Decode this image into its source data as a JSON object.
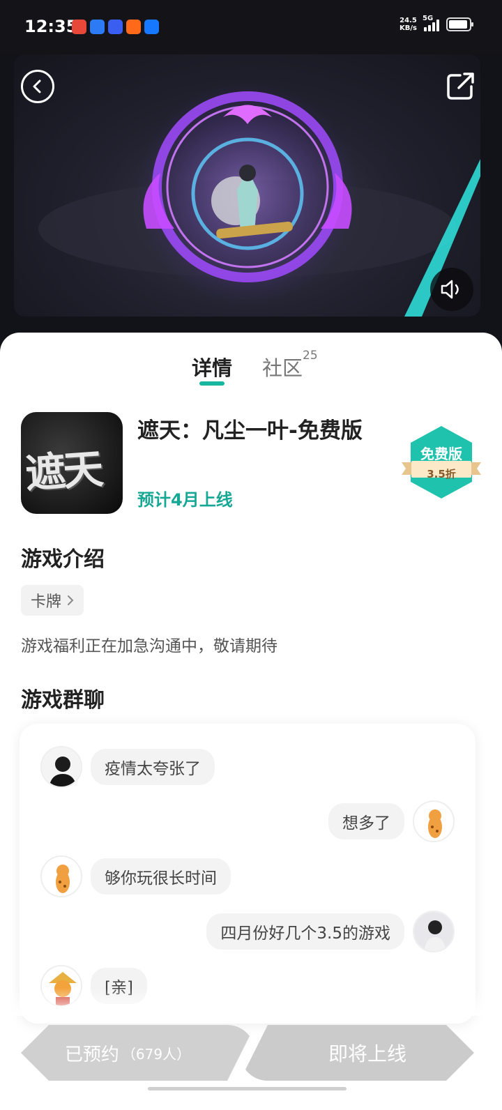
{
  "status_bar": {
    "time": "12:35",
    "net_speed_value": "24.5",
    "net_speed_unit": "KB/s",
    "network": "5G",
    "app_icons": [
      {
        "name": "map-app-icon",
        "color": "#e8483a"
      },
      {
        "name": "cloud-app-icon",
        "color": "#2d7bf4"
      },
      {
        "name": "vivo-app-icon",
        "color": "#3a5ef0"
      },
      {
        "name": "taobao-app-icon",
        "color": "#ff6a1a"
      },
      {
        "name": "alipay-app-icon",
        "color": "#1677ff"
      }
    ]
  },
  "tabs": {
    "detail": "详情",
    "community": "社区",
    "community_count": "25"
  },
  "game": {
    "icon_text": "遮天",
    "title": "遮天：凡尘一叶-免费版",
    "release": "预计4月上线",
    "badge_label": "免费版",
    "badge_discount": "3.5折"
  },
  "intro": {
    "heading": "游戏介绍",
    "tag": "卡牌",
    "text": "游戏福利正在加急沟通中，敬请期待"
  },
  "group_chat": {
    "heading": "游戏群聊",
    "messages": [
      {
        "side": "left",
        "text": "疫情太夸张了"
      },
      {
        "side": "right",
        "text": "想多了"
      },
      {
        "side": "left",
        "text": "够你玩很长时间"
      },
      {
        "side": "right",
        "text": "四月份好几个3.5的游戏"
      },
      {
        "side": "left",
        "text": "[亲]"
      }
    ]
  },
  "actions": {
    "reserved": "已预约",
    "reserved_count": "（679人）",
    "launch": "即将上线"
  },
  "colors": {
    "accent": "#17b6a0",
    "release_text": "#17a895"
  }
}
